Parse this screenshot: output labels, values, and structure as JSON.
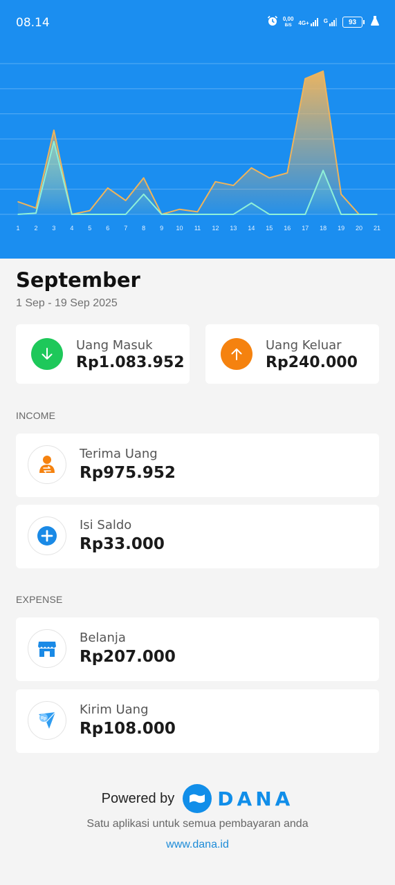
{
  "status_bar": {
    "time": "08.14",
    "net_speed_value": "0,00",
    "net_speed_unit": "B/S",
    "network_4g": "4G+",
    "network_g": "G",
    "battery": "93"
  },
  "chart_data": {
    "type": "area",
    "x": [
      "1",
      "2",
      "3",
      "4",
      "5",
      "6",
      "7",
      "8",
      "9",
      "10",
      "11",
      "12",
      "13",
      "14",
      "15",
      "16",
      "17",
      "18",
      "19",
      "20",
      "21"
    ],
    "series": [
      {
        "values": [
          50000,
          25000,
          335000,
          0,
          15000,
          105000,
          55000,
          145000,
          0,
          20000,
          10000,
          130000,
          115000,
          185000,
          145000,
          165000,
          540000,
          570000,
          80000,
          0,
          0
        ],
        "color": "#f0b45a"
      },
      {
        "values": [
          0,
          5000,
          290000,
          0,
          0,
          0,
          0,
          80000,
          0,
          0,
          0,
          0,
          0,
          45000,
          0,
          0,
          0,
          175000,
          0,
          0,
          0
        ],
        "color": "#8ff0d8"
      }
    ],
    "ylim": [
      0,
      600000
    ],
    "grid": true
  },
  "period": {
    "month": "September",
    "range": "1 Sep - 19 Sep 2025"
  },
  "summary": {
    "income": {
      "label": "Uang Masuk",
      "value": "Rp1.083.952",
      "color": "#1ec85a",
      "icon": "arrow-down-icon"
    },
    "expense": {
      "label": "Uang Keluar",
      "value": "Rp240.000",
      "color": "#f5820f",
      "icon": "arrow-up-icon"
    }
  },
  "income_section": {
    "title": "INCOME",
    "items": [
      {
        "label": "Terima Uang",
        "value": "Rp975.952",
        "icon": "receive-money-icon"
      },
      {
        "label": "Isi Saldo",
        "value": "Rp33.000",
        "icon": "top-up-icon"
      }
    ]
  },
  "expense_section": {
    "title": "EXPENSE",
    "items": [
      {
        "label": "Belanja",
        "value": "Rp207.000",
        "icon": "store-icon"
      },
      {
        "label": "Kirim Uang",
        "value": "Rp108.000",
        "icon": "send-money-icon"
      }
    ]
  },
  "footer": {
    "powered_by": "Powered by",
    "brand": "DANA",
    "tagline": "Satu aplikasi untuk semua pembayaran anda",
    "link": "www.dana.id"
  },
  "colors": {
    "header": "#1b8ef0",
    "brand_blue": "#118ee9"
  }
}
